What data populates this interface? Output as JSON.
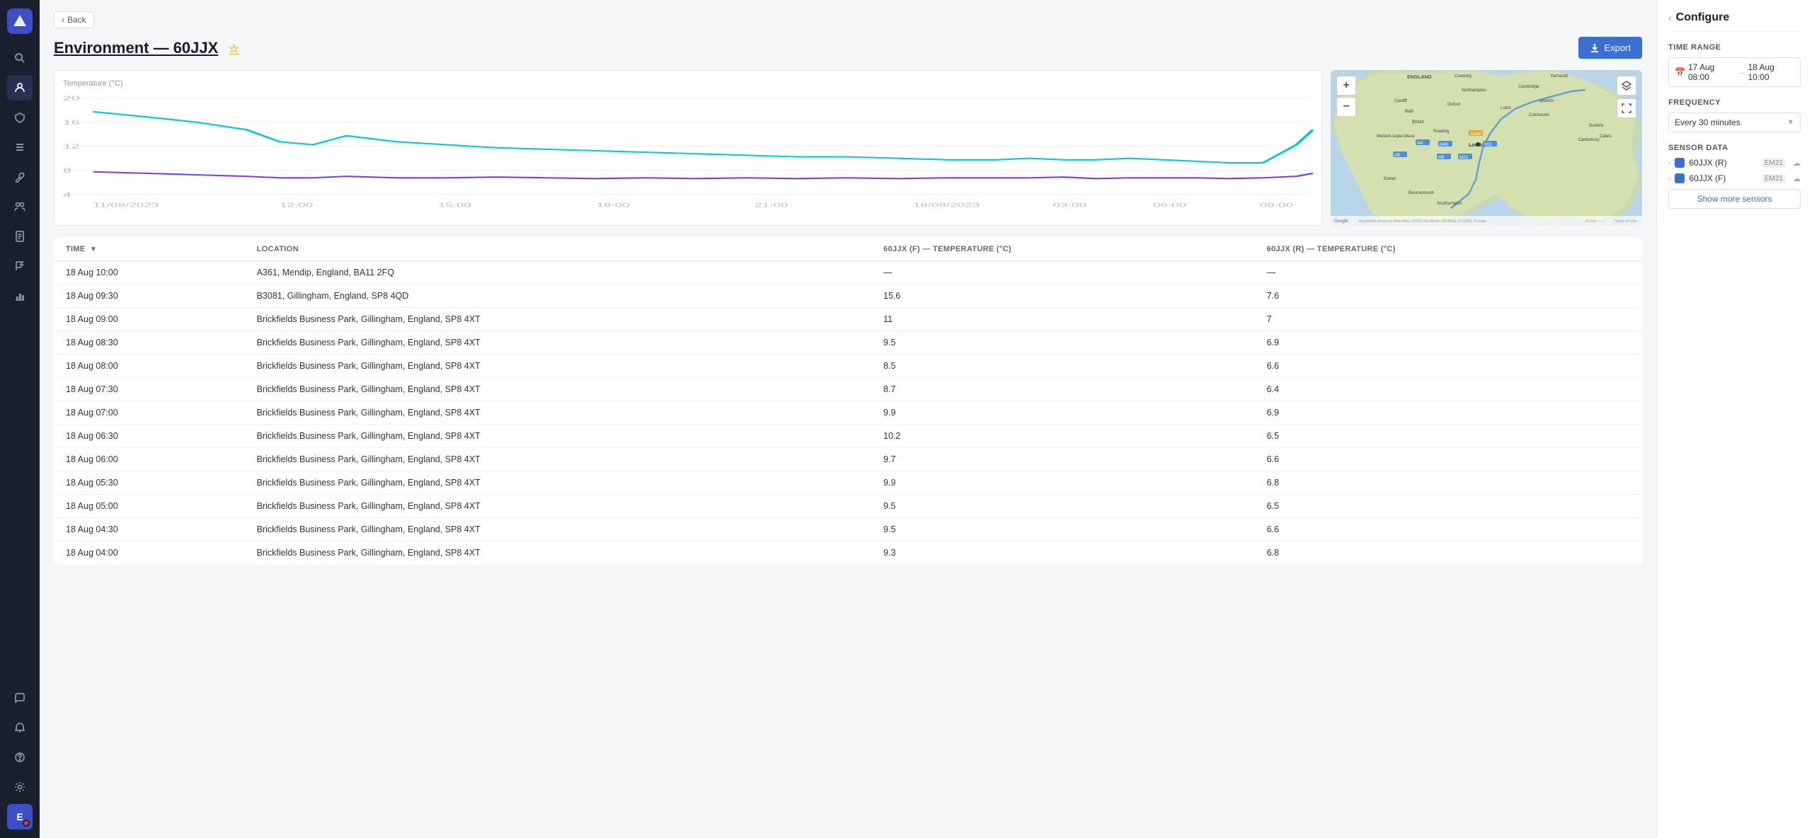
{
  "sidebar": {
    "logo": "V",
    "icons": [
      {
        "name": "search-icon",
        "symbol": "🔍",
        "active": false
      },
      {
        "name": "user-icon",
        "symbol": "👤",
        "active": true
      },
      {
        "name": "shield-icon",
        "symbol": "🛡",
        "active": false
      },
      {
        "name": "list-icon",
        "symbol": "☰",
        "active": false
      },
      {
        "name": "wrench-icon",
        "symbol": "🔧",
        "active": false
      },
      {
        "name": "group-icon",
        "symbol": "👥",
        "active": false
      },
      {
        "name": "doc-icon",
        "symbol": "📄",
        "active": false
      },
      {
        "name": "flag-icon",
        "symbol": "⚑",
        "active": false
      },
      {
        "name": "chart-icon",
        "symbol": "📊",
        "active": false
      }
    ],
    "bottom_icons": [
      {
        "name": "chat-icon",
        "symbol": "💬"
      },
      {
        "name": "bell-icon",
        "symbol": "🔔"
      },
      {
        "name": "help-icon",
        "symbol": "?"
      },
      {
        "name": "settings-icon",
        "symbol": "⚙"
      },
      {
        "name": "user-avatar",
        "symbol": "E",
        "has_badge": true
      }
    ]
  },
  "back_button": "Back",
  "page": {
    "title_prefix": "Environment — ",
    "title_id": "60JJX",
    "export_label": "Export"
  },
  "chart": {
    "y_label": "Temperature (°C)",
    "y_ticks": [
      "20",
      "16",
      "12",
      "8",
      "4"
    ],
    "x_ticks": [
      "11/08/2023",
      "12:00",
      "15:00",
      "18:00",
      "21:00",
      "18/08/2023",
      "03:00",
      "06:00",
      "09:00"
    ]
  },
  "configure": {
    "title": "Configure",
    "time_range": {
      "label": "Time Range",
      "from": "17 Aug 08:00",
      "to": "18 Aug 10:00"
    },
    "frequency": {
      "label": "Frequency",
      "value": "Every 30 minutes"
    },
    "sensor_data": {
      "label": "Sensor Data",
      "sensors": [
        {
          "id": "60JJX (R)",
          "badge": "EM21",
          "color": "blue"
        },
        {
          "id": "60JJX (F)",
          "badge": "EM21",
          "color": "blue"
        }
      ],
      "show_more": "Show more sensors"
    }
  },
  "table": {
    "columns": [
      "TIME",
      "LOCATION",
      "60JJX (F) — TEMPERATURE (°C)",
      "60JJX (R) — TEMPERATURE (°C)"
    ],
    "rows": [
      {
        "time": "18 Aug 10:00",
        "location": "A361, Mendip, England, BA11 2FQ",
        "f_temp": "—",
        "r_temp": "—"
      },
      {
        "time": "18 Aug 09:30",
        "location": "B3081, Gillingham, England, SP8 4QD",
        "f_temp": "15.6",
        "r_temp": "7.6"
      },
      {
        "time": "18 Aug 09:00",
        "location": "Brickfields Business Park, Gillingham, England, SP8 4XT",
        "f_temp": "11",
        "r_temp": "7"
      },
      {
        "time": "18 Aug 08:30",
        "location": "Brickfields Business Park, Gillingham, England, SP8 4XT",
        "f_temp": "9.5",
        "r_temp": "6.9"
      },
      {
        "time": "18 Aug 08:00",
        "location": "Brickfields Business Park, Gillingham, England, SP8 4XT",
        "f_temp": "8.5",
        "r_temp": "6.6"
      },
      {
        "time": "18 Aug 07:30",
        "location": "Brickfields Business Park, Gillingham, England, SP8 4XT",
        "f_temp": "8.7",
        "r_temp": "6.4"
      },
      {
        "time": "18 Aug 07:00",
        "location": "Brickfields Business Park, Gillingham, England, SP8 4XT",
        "f_temp": "9.9",
        "r_temp": "6.9"
      },
      {
        "time": "18 Aug 06:30",
        "location": "Brickfields Business Park, Gillingham, England, SP8 4XT",
        "f_temp": "10.2",
        "r_temp": "6.5"
      },
      {
        "time": "18 Aug 06:00",
        "location": "Brickfields Business Park, Gillingham, England, SP8 4XT",
        "f_temp": "9.7",
        "r_temp": "6.6"
      },
      {
        "time": "18 Aug 05:30",
        "location": "Brickfields Business Park, Gillingham, England, SP8 4XT",
        "f_temp": "9.9",
        "r_temp": "6.8"
      },
      {
        "time": "18 Aug 05:00",
        "location": "Brickfields Business Park, Gillingham, England, SP8 4XT",
        "f_temp": "9.5",
        "r_temp": "6.5"
      },
      {
        "time": "18 Aug 04:30",
        "location": "Brickfields Business Park, Gillingham, England, SP8 4XT",
        "f_temp": "9.5",
        "r_temp": "6.6"
      },
      {
        "time": "18 Aug 04:00",
        "location": "Brickfields Business Park, Gillingham, England, SP8 4XT",
        "f_temp": "9.3",
        "r_temp": "6.8"
      }
    ]
  }
}
